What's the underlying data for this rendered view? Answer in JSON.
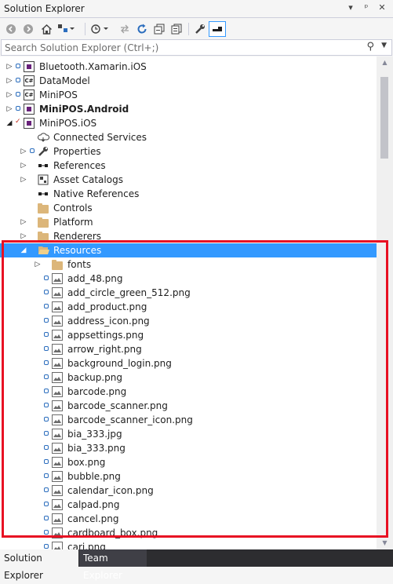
{
  "window": {
    "title": "Solution Explorer",
    "controls": [
      "▾",
      "ᵖ",
      "✕"
    ]
  },
  "toolbar": {
    "icons": [
      "back-icon",
      "forward-icon",
      "home-icon",
      "switch-views-icon",
      "pending-changes-icon",
      "sync-icon",
      "refresh-icon",
      "collapse-all-icon",
      "show-all-files-icon",
      "properties-icon",
      "preview-icon"
    ]
  },
  "search": {
    "placeholder": "Search Solution Explorer (Ctrl+;)"
  },
  "tree": {
    "items": [
      {
        "label": "Bluetooth.Xamarin.iOS",
        "indent": 0,
        "icon": "project",
        "exp": "closed",
        "lock": true
      },
      {
        "label": "DataModel",
        "indent": 0,
        "icon": "cs-project",
        "exp": "closed",
        "lock": true
      },
      {
        "label": "MiniPOS",
        "indent": 0,
        "icon": "cs-project",
        "exp": "closed",
        "lock": true
      },
      {
        "label": "MiniPOS.Android",
        "indent": 0,
        "icon": "project",
        "exp": "closed",
        "lock": true,
        "bold": true
      },
      {
        "label": "MiniPOS.iOS",
        "indent": 0,
        "icon": "project",
        "exp": "open",
        "check": true
      },
      {
        "label": "Connected Services",
        "indent": 1,
        "icon": "connected"
      },
      {
        "label": "Properties",
        "indent": 1,
        "icon": "wrench",
        "exp": "closed",
        "lock": true
      },
      {
        "label": "References",
        "indent": 1,
        "icon": "refs",
        "exp": "closed"
      },
      {
        "label": "Asset Catalogs",
        "indent": 1,
        "icon": "asset",
        "exp": "closed"
      },
      {
        "label": "Native References",
        "indent": 1,
        "icon": "refs"
      },
      {
        "label": "Controls",
        "indent": 1,
        "icon": "folder"
      },
      {
        "label": "Platform",
        "indent": 1,
        "icon": "folder",
        "exp": "closed"
      },
      {
        "label": "Renderers",
        "indent": 1,
        "icon": "folder",
        "exp": "closed"
      },
      {
        "label": "Resources",
        "indent": 1,
        "icon": "folder-open",
        "exp": "open",
        "selected": true
      },
      {
        "label": "fonts",
        "indent": 2,
        "icon": "folder",
        "exp": "closed"
      },
      {
        "label": "add_48.png",
        "indent": 2,
        "icon": "image",
        "lock": true
      },
      {
        "label": "add_circle_green_512.png",
        "indent": 2,
        "icon": "image",
        "lock": true
      },
      {
        "label": "add_product.png",
        "indent": 2,
        "icon": "image",
        "lock": true
      },
      {
        "label": "address_icon.png",
        "indent": 2,
        "icon": "image",
        "lock": true
      },
      {
        "label": "appsettings.png",
        "indent": 2,
        "icon": "image",
        "lock": true
      },
      {
        "label": "arrow_right.png",
        "indent": 2,
        "icon": "image",
        "lock": true
      },
      {
        "label": "background_login.png",
        "indent": 2,
        "icon": "image",
        "lock": true
      },
      {
        "label": "backup.png",
        "indent": 2,
        "icon": "image",
        "lock": true
      },
      {
        "label": "barcode.png",
        "indent": 2,
        "icon": "image",
        "lock": true
      },
      {
        "label": "barcode_scanner.png",
        "indent": 2,
        "icon": "image",
        "lock": true
      },
      {
        "label": "barcode_scanner_icon.png",
        "indent": 2,
        "icon": "image",
        "lock": true
      },
      {
        "label": "bia_333.jpg",
        "indent": 2,
        "icon": "image",
        "lock": true
      },
      {
        "label": "bia_333.png",
        "indent": 2,
        "icon": "image",
        "lock": true
      },
      {
        "label": "box.png",
        "indent": 2,
        "icon": "image",
        "lock": true
      },
      {
        "label": "bubble.png",
        "indent": 2,
        "icon": "image",
        "lock": true
      },
      {
        "label": "calendar_icon.png",
        "indent": 2,
        "icon": "image",
        "lock": true
      },
      {
        "label": "calpad.png",
        "indent": 2,
        "icon": "image",
        "lock": true
      },
      {
        "label": "cancel.png",
        "indent": 2,
        "icon": "image",
        "lock": true
      },
      {
        "label": "cardboard_box.png",
        "indent": 2,
        "icon": "image",
        "lock": true
      },
      {
        "label": "cari.png",
        "indent": 2,
        "icon": "image",
        "lock": true
      }
    ]
  },
  "tabs": [
    {
      "label": "Solution Explorer",
      "active": true
    },
    {
      "label": "Team Explorer",
      "active": false
    }
  ]
}
